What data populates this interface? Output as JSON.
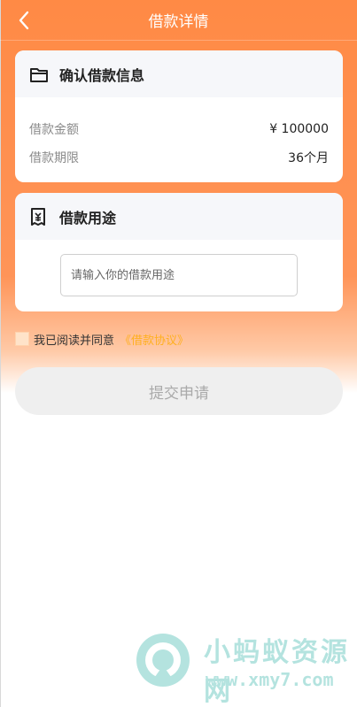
{
  "header": {
    "title": "借款详情",
    "back_icon": "chevron-left-icon"
  },
  "confirm_card": {
    "title": "确认借款信息",
    "icon": "wallet-icon",
    "rows": [
      {
        "label": "借款金额",
        "value": "¥ 100000"
      },
      {
        "label": "借款期限",
        "value": "36个月"
      }
    ]
  },
  "purpose_card": {
    "title": "借款用途",
    "icon": "receipt-icon",
    "input_placeholder": "请输入你的借款用途",
    "input_value": ""
  },
  "agreement": {
    "text": "我已阅读并同意",
    "link": "《借款协议》",
    "checked": false
  },
  "submit_label": "提交申请",
  "watermark": {
    "name": "小蚂蚁资源网",
    "url": "www.xmy7.com"
  },
  "colors": {
    "primary": "#ff8a45",
    "link": "#ffb020",
    "button_bg": "#efefef",
    "watermark": "#2bb2a6"
  }
}
